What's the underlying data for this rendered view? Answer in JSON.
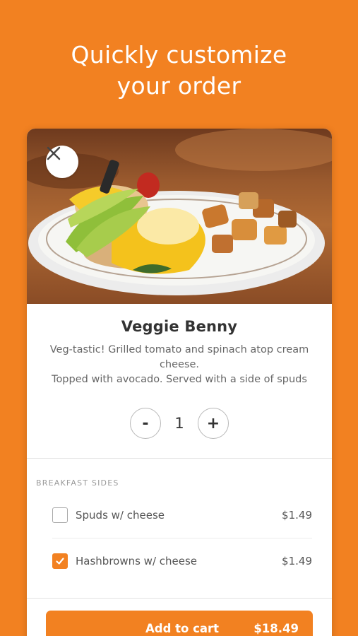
{
  "headline": {
    "line1": "Quickly customize",
    "line2": "your order"
  },
  "item": {
    "name": "Veggie Benny",
    "description_line1": "Veg-tastic! Grilled tomato and spinach atop cream",
    "description_line2": "cheese.",
    "description_line3": "Topped with avocado. Served with a side of spuds",
    "quantity": "1",
    "decrement_label": "-",
    "increment_label": "+"
  },
  "sides": {
    "header": "BREAKFAST SIDES",
    "options": [
      {
        "label": "Spuds w/ cheese",
        "price": "$1.49",
        "checked": false
      },
      {
        "label": "Hashbrowns w/ cheese",
        "price": "$1.49",
        "checked": true
      }
    ]
  },
  "cart": {
    "label": "Add to cart",
    "total": "$18.49"
  },
  "colors": {
    "accent": "#f28121",
    "text": "#333333"
  },
  "icons": {
    "close": "close-icon",
    "check": "checkmark-icon"
  }
}
